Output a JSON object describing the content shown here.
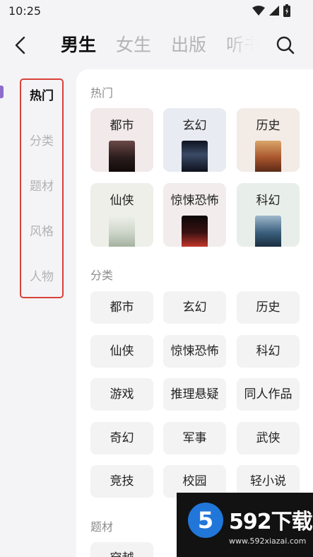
{
  "status_bar": {
    "time": "10:25"
  },
  "nav": {
    "tabs": [
      {
        "label": "男生",
        "active": true
      },
      {
        "label": "女生",
        "active": false
      },
      {
        "label": "出版",
        "active": false
      },
      {
        "label": "听书",
        "active": false
      }
    ]
  },
  "rail": {
    "items": [
      {
        "label": "热门",
        "active": true
      },
      {
        "label": "分类",
        "active": false
      },
      {
        "label": "题材",
        "active": false
      },
      {
        "label": "风格",
        "active": false
      },
      {
        "label": "人物",
        "active": false
      }
    ]
  },
  "hot": {
    "title": "热门",
    "cards": [
      {
        "label": "都市",
        "bg": "#f1e9ea",
        "cover": "#2a1c1c"
      },
      {
        "label": "玄幻",
        "bg": "#e8ebf1",
        "cover": "#1f2736"
      },
      {
        "label": "历史",
        "bg": "#f3ebe6",
        "cover": "#a8552c"
      },
      {
        "label": "仙侠",
        "bg": "#efefea",
        "cover": "#cdd5c9"
      },
      {
        "label": "惊悚恐怖",
        "bg": "#f2ecec",
        "cover": "#1d0e0e"
      },
      {
        "label": "科幻",
        "bg": "#e8efeb",
        "cover": "#3a5f7c"
      }
    ]
  },
  "category": {
    "title": "分类",
    "items": [
      "都市",
      "玄幻",
      "历史",
      "仙侠",
      "惊悚恐怖",
      "科幻",
      "游戏",
      "推理悬疑",
      "同人作品",
      "奇幻",
      "军事",
      "武侠",
      "竞技",
      "校园",
      "轻小说"
    ]
  },
  "theme": {
    "title": "题材",
    "items": [
      "穿越"
    ]
  },
  "watermark": {
    "brand": "592下载",
    "url": "www.592xiazai.com",
    "badge": "5"
  }
}
